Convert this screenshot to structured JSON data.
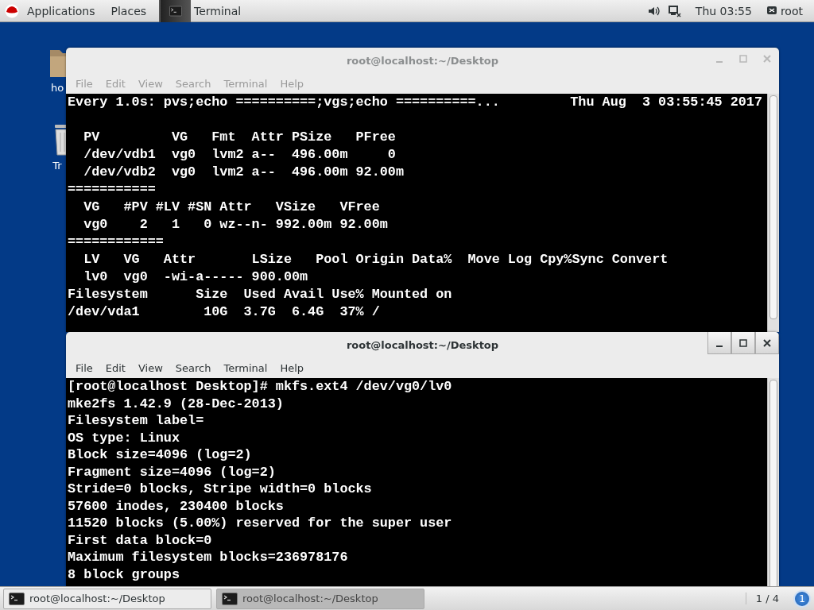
{
  "top_bar": {
    "menus": [
      "Applications",
      "Places"
    ],
    "app": "Terminal",
    "clock": "Thu 03:55",
    "user": "root"
  },
  "desktop_icons": [
    {
      "kind": "folder",
      "label": "ho"
    },
    {
      "kind": "trash",
      "label": "Tr"
    }
  ],
  "windows": [
    {
      "title": "root@localhost:~/Desktop",
      "selected": false,
      "menu": [
        "File",
        "Edit",
        "View",
        "Search",
        "Terminal",
        "Help"
      ],
      "header": {
        "command": "Every 1.0s: pvs;echo ==========;vgs;echo ==========...",
        "time": "Thu Aug  3 03:55:45 2017"
      },
      "lines": [
        "  PV         VG   Fmt  Attr PSize   PFree ",
        "  /dev/vdb1  vg0  lvm2 a--  496.00m     0 ",
        "  /dev/vdb2  vg0  lvm2 a--  496.00m 92.00m",
        "===========",
        "  VG   #PV #LV #SN Attr   VSize   VFree ",
        "  vg0    2   1   0 wz--n- 992.00m 92.00m",
        "============",
        "  LV   VG   Attr       LSize   Pool Origin Data%  Move Log Cpy%Sync Convert",
        "  lv0  vg0  -wi-a----- 900.00m",
        "Filesystem      Size  Used Avail Use% Mounted on",
        "/dev/vda1        10G  3.7G  6.4G  37% /"
      ]
    },
    {
      "title": "root@localhost:~/Desktop",
      "selected": true,
      "menu": [
        "File",
        "Edit",
        "View",
        "Search",
        "Terminal",
        "Help"
      ],
      "lines": [
        "[root@localhost Desktop]# mkfs.ext4 /dev/vg0/lv0",
        "mke2fs 1.42.9 (28-Dec-2013)",
        "Filesystem label=",
        "OS type: Linux",
        "Block size=4096 (log=2)",
        "Fragment size=4096 (log=2)",
        "Stride=0 blocks, Stripe width=0 blocks",
        "57600 inodes, 230400 blocks",
        "11520 blocks (5.00%) reserved for the super user",
        "First data block=0",
        "Maximum filesystem blocks=236978176",
        "8 block groups"
      ]
    }
  ],
  "taskbar": {
    "items": [
      {
        "label": "root@localhost:~/Desktop",
        "selected": false
      },
      {
        "label": "root@localhost:~/Desktop",
        "selected": true
      }
    ],
    "workspace": "1 / 4",
    "notifications": "1"
  }
}
